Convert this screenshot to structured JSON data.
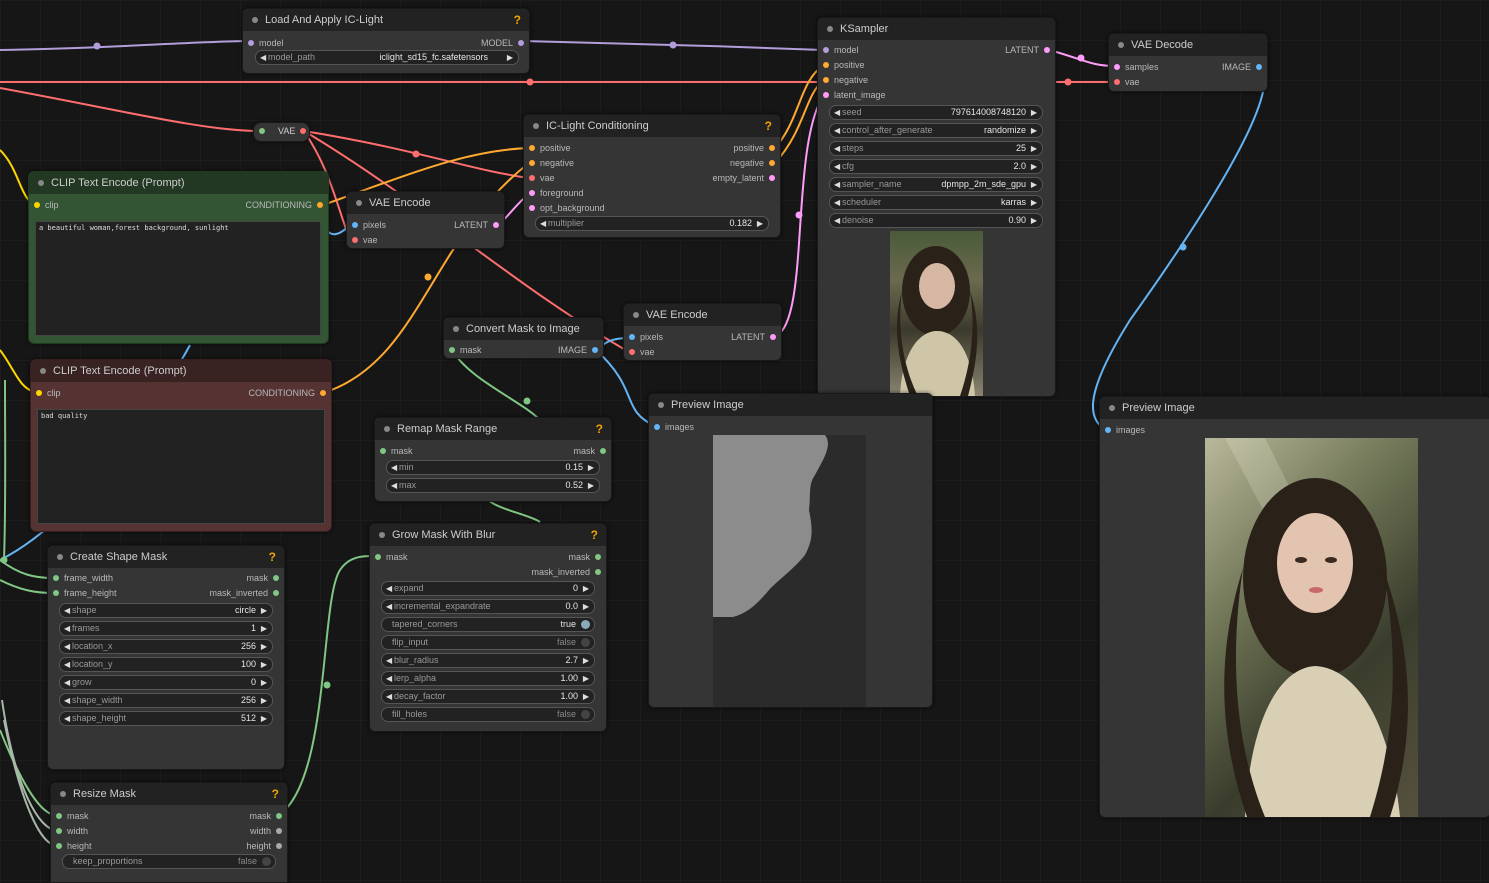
{
  "colors": {
    "model": "#b39ddb",
    "conditioning": "#ffa931",
    "vae": "#ff6e6e",
    "latent": "#ff9cf9",
    "image": "#64b5f6",
    "mask": "#81c784",
    "clip": "#ffd500",
    "help": "#f0a400"
  },
  "help_mark": "?",
  "arrow_left": "◀",
  "arrow_right": "▶",
  "load_iclight": {
    "title": "Load And Apply IC-Light",
    "in_model": "model",
    "out_model": "MODEL",
    "model_path_label": "model_path",
    "model_path_value": "iclight_sd15_fc.safetensors"
  },
  "vae_reroute": {
    "label": "VAE"
  },
  "ksampler": {
    "title": "KSampler",
    "inputs": [
      "model",
      "positive",
      "negative",
      "latent_image"
    ],
    "output": "LATENT",
    "widgets": [
      {
        "label": "seed",
        "value": "797614008748120"
      },
      {
        "label": "control_after_generate",
        "value": "randomize"
      },
      {
        "label": "steps",
        "value": "25"
      },
      {
        "label": "cfg",
        "value": "2.0"
      },
      {
        "label": "sampler_name",
        "value": "dpmpp_2m_sde_gpu"
      },
      {
        "label": "scheduler",
        "value": "karras"
      },
      {
        "label": "denoise",
        "value": "0.90"
      }
    ]
  },
  "vae_decode": {
    "title": "VAE Decode",
    "in_samples": "samples",
    "in_vae": "vae",
    "output": "IMAGE"
  },
  "iclight_cond": {
    "title": "IC-Light Conditioning",
    "inputs": [
      "positive",
      "negative",
      "vae",
      "foreground",
      "opt_background"
    ],
    "outputs": [
      "positive",
      "negative",
      "empty_latent"
    ],
    "multiplier_label": "multiplier",
    "multiplier_value": "0.182"
  },
  "clip_pos": {
    "title": "CLIP Text Encode (Prompt)",
    "in_clip": "clip",
    "output": "CONDITIONING",
    "text": "a beautiful woman,forest background, sunlight"
  },
  "clip_neg": {
    "title": "CLIP Text Encode (Prompt)",
    "in_clip": "clip",
    "output": "CONDITIONING",
    "text": "bad quality"
  },
  "vae_encode_1": {
    "title": "VAE Encode",
    "in_pixels": "pixels",
    "in_vae": "vae",
    "output": "LATENT"
  },
  "vae_encode_2": {
    "title": "VAE Encode",
    "in_pixels": "pixels",
    "in_vae": "vae",
    "output": "LATENT"
  },
  "convert_mask": {
    "title": "Convert Mask to Image",
    "in_mask": "mask",
    "output": "IMAGE"
  },
  "preview_mask": {
    "title": "Preview Image",
    "in_images": "images"
  },
  "preview_final": {
    "title": "Preview Image",
    "in_images": "images"
  },
  "remap_mask": {
    "title": "Remap Mask Range",
    "in_mask": "mask",
    "out_mask": "mask",
    "widgets": [
      {
        "label": "min",
        "value": "0.15"
      },
      {
        "label": "max",
        "value": "0.52"
      }
    ]
  },
  "grow_mask": {
    "title": "Grow Mask With Blur",
    "in_mask": "mask",
    "out_mask": "mask",
    "out_mask_inverted": "mask_inverted",
    "widgets": [
      {
        "label": "expand",
        "value": "0",
        "kind": "num"
      },
      {
        "label": "incremental_expandrate",
        "value": "0.0",
        "kind": "num"
      },
      {
        "label": "tapered_corners",
        "value": "true",
        "kind": "toggle_on"
      },
      {
        "label": "flip_input",
        "value": "false",
        "kind": "toggle"
      },
      {
        "label": "blur_radius",
        "value": "2.7",
        "kind": "num"
      },
      {
        "label": "lerp_alpha",
        "value": "1.00",
        "kind": "num"
      },
      {
        "label": "decay_factor",
        "value": "1.00",
        "kind": "num"
      },
      {
        "label": "fill_holes",
        "value": "false",
        "kind": "toggle"
      }
    ]
  },
  "shape_mask": {
    "title": "Create Shape Mask",
    "in_frame_width": "frame_width",
    "in_frame_height": "frame_height",
    "out_mask": "mask",
    "out_mask_inverted": "mask_inverted",
    "widgets": [
      {
        "label": "shape",
        "value": "circle"
      },
      {
        "label": "frames",
        "value": "1"
      },
      {
        "label": "location_x",
        "value": "256"
      },
      {
        "label": "location_y",
        "value": "100"
      },
      {
        "label": "grow",
        "value": "0"
      },
      {
        "label": "shape_width",
        "value": "256"
      },
      {
        "label": "shape_height",
        "value": "512"
      }
    ]
  },
  "resize_mask": {
    "title": "Resize Mask",
    "inputs": [
      "mask",
      "width",
      "height"
    ],
    "outputs": [
      "mask",
      "width",
      "height"
    ],
    "keep_label": "keep_proportions",
    "keep_value": "false"
  }
}
